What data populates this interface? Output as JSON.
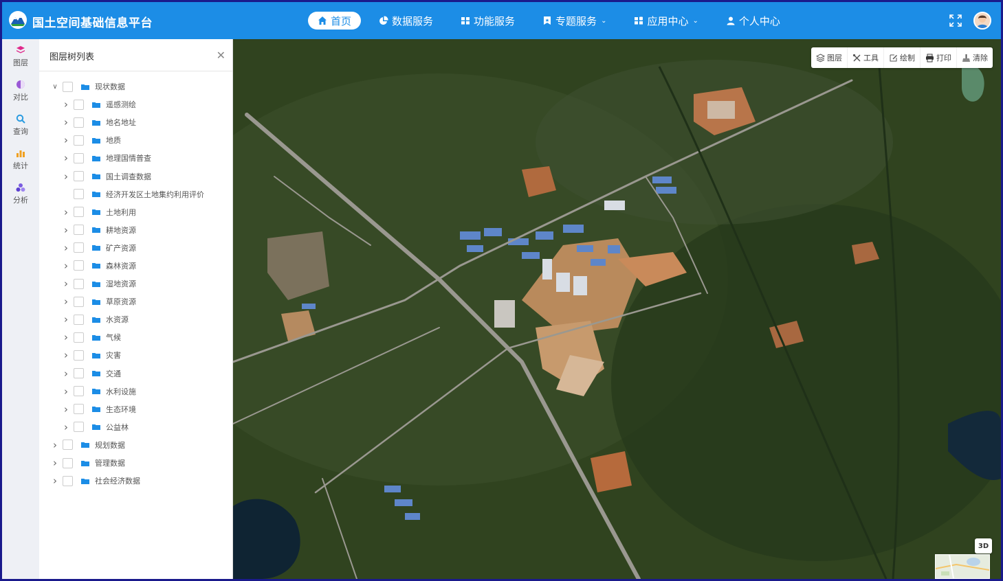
{
  "header": {
    "app_title": "国土空间基础信息平台",
    "nav": [
      {
        "label": "首页",
        "icon": "home-icon",
        "active": true
      },
      {
        "label": "数据服务",
        "icon": "pie-chart-icon"
      },
      {
        "label": "功能服务",
        "icon": "grid-icon"
      },
      {
        "label": "专题服务",
        "icon": "bookmark-icon",
        "dropdown": true
      },
      {
        "label": "应用中心",
        "icon": "apps-icon",
        "dropdown": true
      },
      {
        "label": "个人中心",
        "icon": "user-icon"
      }
    ]
  },
  "rail": [
    {
      "label": "图层",
      "icon": "layers-icon"
    },
    {
      "label": "对比",
      "icon": "compare-icon"
    },
    {
      "label": "查询",
      "icon": "search-icon"
    },
    {
      "label": "统计",
      "icon": "bar-chart-icon"
    },
    {
      "label": "分析",
      "icon": "analysis-icon"
    }
  ],
  "panel": {
    "title": "图层树列表",
    "close_glyph": "✕"
  },
  "tree": [
    {
      "label": "现状数据",
      "level": 0,
      "expanded": true
    },
    {
      "label": "遥感测绘",
      "level": 1
    },
    {
      "label": "地名地址",
      "level": 1
    },
    {
      "label": "地质",
      "level": 1
    },
    {
      "label": "地理国情普查",
      "level": 1
    },
    {
      "label": "国土调查数据",
      "level": 1
    },
    {
      "label": "经济开发区土地集约利用评价",
      "level": 1,
      "leaf": true
    },
    {
      "label": "土地利用",
      "level": 1
    },
    {
      "label": "耕地资源",
      "level": 1
    },
    {
      "label": "矿产资源",
      "level": 1
    },
    {
      "label": "森林资源",
      "level": 1
    },
    {
      "label": "湿地资源",
      "level": 1
    },
    {
      "label": "草原资源",
      "level": 1
    },
    {
      "label": "水资源",
      "level": 1
    },
    {
      "label": "气候",
      "level": 1
    },
    {
      "label": "灾害",
      "level": 1
    },
    {
      "label": "交通",
      "level": 1
    },
    {
      "label": "水利设施",
      "level": 1
    },
    {
      "label": "生态环境",
      "level": 1
    },
    {
      "label": "公益林",
      "level": 1
    },
    {
      "label": "规划数据",
      "level": 0
    },
    {
      "label": "管理数据",
      "level": 0
    },
    {
      "label": "社会经济数据",
      "level": 0
    }
  ],
  "map_toolbar": [
    {
      "label": "图层",
      "icon": "layers-icon"
    },
    {
      "label": "工具",
      "icon": "tools-icon"
    },
    {
      "label": "绘制",
      "icon": "draw-icon"
    },
    {
      "label": "打印",
      "icon": "print-icon"
    },
    {
      "label": "清除",
      "icon": "broom-icon"
    }
  ],
  "map": {
    "mode_button": "3D"
  },
  "colors": {
    "header": "#1c8de6",
    "rail": "#eef0f5",
    "folder": "#1c8de6"
  }
}
